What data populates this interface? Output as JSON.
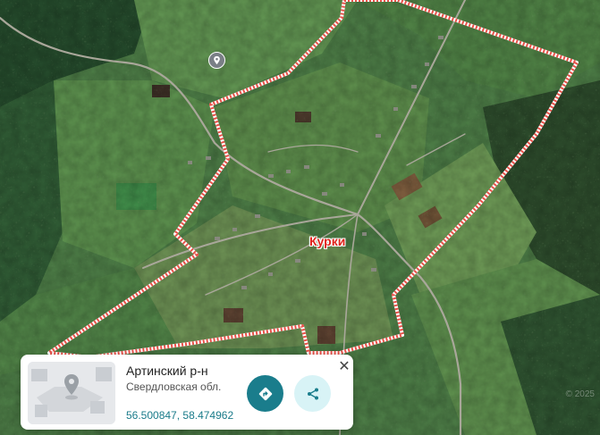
{
  "map": {
    "place_label": "Курки",
    "style": "satellite",
    "boundary_color": "#e8524a",
    "pin_icon": "location-pin-icon"
  },
  "card": {
    "title": "Артинский р-н",
    "subtitle": "Свердловская обл.",
    "coordinates": "56.500847, 58.474962",
    "route_icon": "route-icon",
    "share_icon": "share-icon",
    "close_label": "✕",
    "route_color": "#1a7d8c",
    "share_bg_color": "#d8f3f6"
  }
}
